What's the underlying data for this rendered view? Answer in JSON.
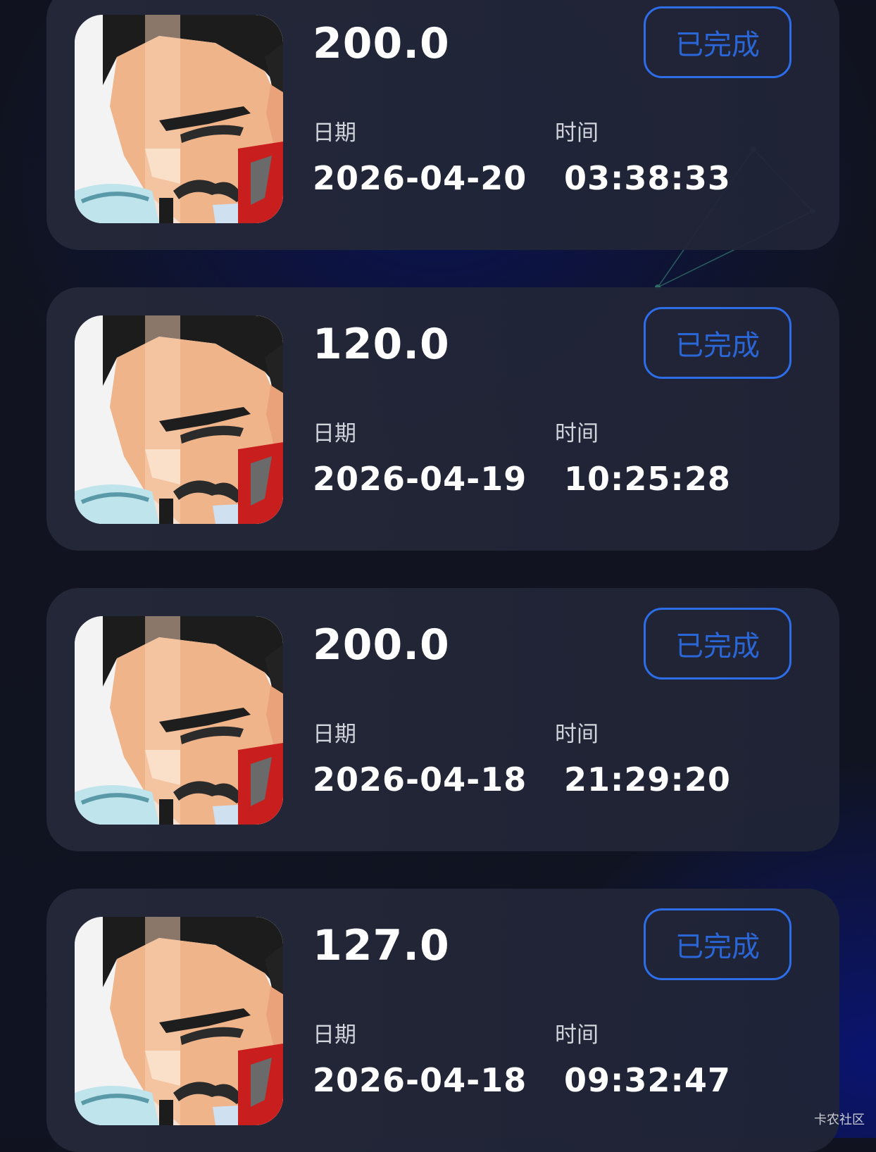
{
  "records": [
    {
      "amount": "200.0",
      "status": "已完成",
      "date_label": "日期",
      "date": "2026-04-20",
      "time_label": "时间",
      "time": "03:38:33"
    },
    {
      "amount": "120.0",
      "status": "已完成",
      "date_label": "日期",
      "date": "2026-04-19",
      "time_label": "时间",
      "time": "10:25:28"
    },
    {
      "amount": "200.0",
      "status": "已完成",
      "date_label": "日期",
      "date": "2026-04-18",
      "time_label": "时间",
      "time": "21:29:20"
    },
    {
      "amount": "127.0",
      "status": "已完成",
      "date_label": "日期",
      "date": "2026-04-18",
      "time_label": "时间",
      "time": "09:32:47"
    }
  ],
  "watermark": "卡农社区",
  "colors": {
    "background": "#111420",
    "card": "#242838",
    "status_accent": "#2d6ee8",
    "text_primary": "#ffffff",
    "text_secondary": "#d2d4dc"
  },
  "icons": {
    "avatar": "cartoon-man-avatar-icon"
  }
}
